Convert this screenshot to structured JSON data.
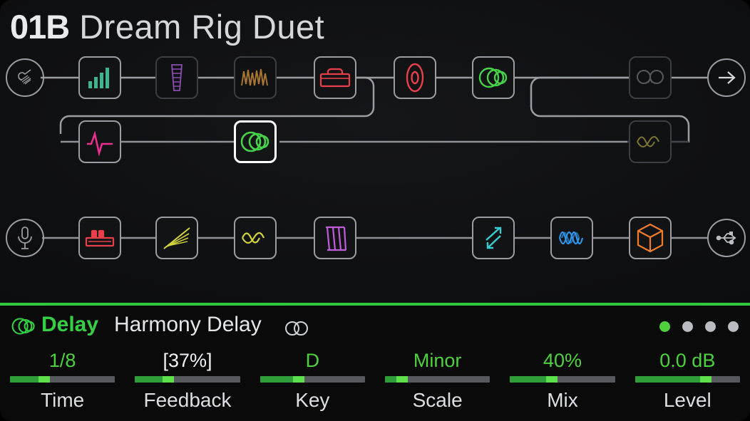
{
  "header": {
    "preset_number": "01B",
    "preset_name": "Dream Rig Duet"
  },
  "colors": {
    "accent_green": "#2fc93f",
    "value_green": "#4fd13f",
    "editing_white": "#f0f2f4",
    "wire": "#9a9da2",
    "wire_dim": "#3b3e43",
    "panel_bg": "#0a0a0b",
    "chain_bg": "#131418"
  },
  "chain": {
    "row1": {
      "input_icon": "guitar-input-icon",
      "output_icon": "output-arrow-icon",
      "blocks": [
        {
          "name": "compressor",
          "icon": "bar-meter-icon",
          "color": "#3fb58e",
          "state": "active"
        },
        {
          "name": "equalizer",
          "icon": "eq-ladder-icon",
          "color": "#a05cc8",
          "state": "bypassed"
        },
        {
          "name": "distortion",
          "icon": "distortion-wave-icon",
          "color": "#c98a3a",
          "state": "bypassed"
        },
        {
          "name": "amplifier",
          "icon": "amp-head-icon",
          "color": "#e8404a",
          "state": "active"
        },
        {
          "name": "cabinet",
          "icon": "speaker-cab-icon",
          "color": "#e8404a",
          "state": "active"
        },
        {
          "name": "delay",
          "icon": "delay-circles-icon",
          "color": "#46d34a",
          "state": "active"
        },
        {
          "name": "reverb",
          "icon": "reverb-spring-icon",
          "color": "#4a4d52",
          "state": "bypassed"
        }
      ]
    },
    "row2": {
      "blocks": [
        {
          "name": "pitch",
          "icon": "transient-spike-icon",
          "color": "#ea2f8f",
          "state": "active"
        },
        {
          "name": "delay-2",
          "icon": "delay-circles-icon",
          "color": "#46d34a",
          "state": "selected"
        },
        {
          "name": "modulation",
          "icon": "mod-wave-icon",
          "color": "#7d7530",
          "state": "bypassed"
        }
      ]
    },
    "row3": {
      "input_icon": "microphone-input-icon",
      "output_icon": "usb-output-icon",
      "blocks": [
        {
          "name": "preamp",
          "icon": "preamp-icon",
          "color": "#e8404a",
          "state": "active"
        },
        {
          "name": "expander",
          "icon": "expander-lines-icon",
          "color": "#d3d33c",
          "state": "active"
        },
        {
          "name": "de-esser",
          "icon": "wave-fold-icon",
          "color": "#d3d33c",
          "state": "active"
        },
        {
          "name": "vocal-eq",
          "icon": "eq-slant-icon",
          "color": "#c05cd8",
          "state": "active"
        },
        {
          "name": "doubler",
          "icon": "double-arrow-icon",
          "color": "#35cdd1",
          "state": "active"
        },
        {
          "name": "chorus",
          "icon": "chorus-wave-icon",
          "color": "#2f95e8",
          "state": "active"
        },
        {
          "name": "space",
          "icon": "cube-icon",
          "color": "#ef7d2c",
          "state": "active"
        }
      ]
    }
  },
  "panel": {
    "category": "Delay",
    "model": "Harmony Delay",
    "category_icon": "delay-circles-icon",
    "stereo_icon": "stereo-icon",
    "pages": [
      {
        "active": true
      },
      {
        "active": false
      },
      {
        "active": false
      },
      {
        "active": false
      }
    ],
    "parameters": [
      {
        "label": "Time",
        "value": "1/8",
        "fill": 38,
        "editing": false
      },
      {
        "label": "Feedback",
        "value": "[37%]",
        "fill": 37,
        "editing": true
      },
      {
        "label": "Key",
        "value": "D",
        "fill": 42,
        "editing": false
      },
      {
        "label": "Scale",
        "value": "Minor",
        "fill": 22,
        "editing": false
      },
      {
        "label": "Mix",
        "value": "40%",
        "fill": 45,
        "editing": false
      },
      {
        "label": "Level",
        "value": "0.0 dB",
        "fill": 73,
        "editing": false
      }
    ]
  }
}
